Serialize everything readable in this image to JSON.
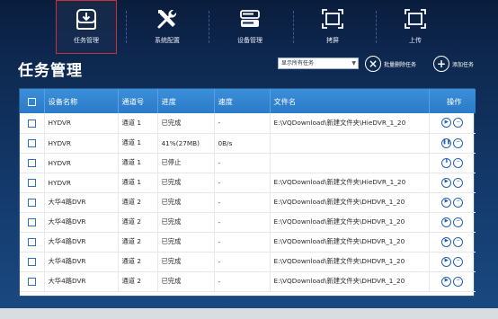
{
  "nav": [
    {
      "label": "任务管理",
      "icon": "download-icon",
      "active": true
    },
    {
      "label": "系统配置",
      "icon": "tools-icon",
      "active": false
    },
    {
      "label": "设备管理",
      "icon": "server-icon",
      "active": false
    },
    {
      "label": "拷屏",
      "icon": "screenshot-icon",
      "active": false
    },
    {
      "label": "上传",
      "icon": "upload-icon",
      "active": false
    }
  ],
  "page": {
    "title": "任务管理",
    "filter_value": "显示所有任务",
    "batch_delete_label": "批量删除任务",
    "add_task_label": "添加任务"
  },
  "table": {
    "columns": [
      "设备名称",
      "通道号",
      "进度",
      "速度",
      "文件名",
      "操作"
    ],
    "rows": [
      {
        "device": "HYDVR",
        "channel": "通道 1",
        "progress": "已完成",
        "speed": "-",
        "file": "E:\\VQDownload\\新建文件夹\\HieDVR_1_20",
        "action": "play"
      },
      {
        "device": "HYDVR",
        "channel": "通道 1",
        "progress": "41%(27MB)",
        "speed": "0B/s",
        "file": "",
        "action": "pause"
      },
      {
        "device": "HYDVR",
        "channel": "通道 1",
        "progress": "已停止",
        "speed": "-",
        "file": "",
        "action": "download"
      },
      {
        "device": "HYDVR",
        "channel": "通道 1",
        "progress": "已完成",
        "speed": "-",
        "file": "E:\\VQDownload\\新建文件夹\\HieDVR_1_20",
        "action": "play"
      },
      {
        "device": "大华4路DVR",
        "channel": "通道 2",
        "progress": "已完成",
        "speed": "-",
        "file": "E:\\VQDownload\\新建文件夹\\DHDVR_1_20",
        "action": "play"
      },
      {
        "device": "大华4路DVR",
        "channel": "通道 2",
        "progress": "已完成",
        "speed": "-",
        "file": "E:\\VQDownload\\新建文件夹\\DHDVR_1_20",
        "action": "play"
      },
      {
        "device": "大华4路DVR",
        "channel": "通道 2",
        "progress": "已完成",
        "speed": "-",
        "file": "E:\\VQDownload\\新建文件夹\\DHDVR_1_20",
        "action": "play"
      },
      {
        "device": "大华4路DVR",
        "channel": "通道 2",
        "progress": "已完成",
        "speed": "-",
        "file": "E:\\VQDownload\\新建文件夹\\DHDVR_1_20",
        "action": "play"
      },
      {
        "device": "大华4路DVR",
        "channel": "通道 2",
        "progress": "已完成",
        "speed": "-",
        "file": "E:\\VQDownload\\新建文件夹\\DHDVR_1_20",
        "action": "play"
      }
    ]
  },
  "colors": {
    "background": "#13396b",
    "header_blue": "#2b7bc8",
    "active_outline": "#c7323a",
    "icon_blue": "#2360a8"
  }
}
